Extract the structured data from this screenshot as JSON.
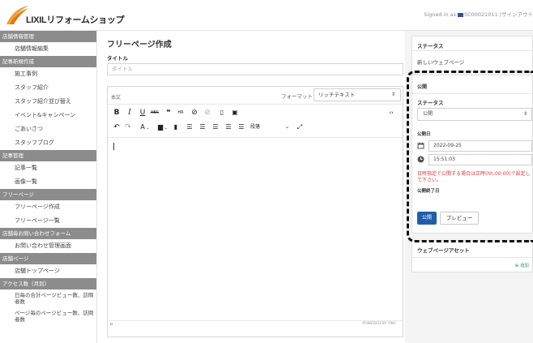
{
  "header": {
    "logo_text": "LIXILリフォームショップ",
    "signed_in_prefix": "Signed in as",
    "user_id": "SC00021011",
    "signout": "|サインアウト"
  },
  "sidebar": {
    "sections": [
      {
        "title": "店舗情報管理",
        "items": [
          {
            "label": "店舗情報編集"
          }
        ]
      },
      {
        "title": "記事新規作成",
        "items": [
          {
            "label": "施工事例"
          },
          {
            "label": "スタッフ紹介"
          },
          {
            "label": "スタッフ紹介並び替え"
          },
          {
            "label": "イベント&キャンペーン"
          },
          {
            "label": "ごあいさつ"
          },
          {
            "label": "スタッフブログ"
          }
        ]
      },
      {
        "title": "記事管理",
        "items": [
          {
            "label": "記事一覧"
          },
          {
            "label": "画像一覧"
          }
        ]
      },
      {
        "title": "フリーページ",
        "items": [
          {
            "label": "フリーページ作成"
          },
          {
            "label": "フリーページ一覧"
          }
        ]
      },
      {
        "title": "店舗毎お問い合わせフォーム",
        "items": [
          {
            "label": "お問い合わせ管理画面"
          }
        ]
      },
      {
        "title": "店舗ページ",
        "items": [
          {
            "label": "店舗トップページ"
          }
        ]
      },
      {
        "title": "アクセス数（月別）",
        "items": [
          {
            "label": "日毎の合計ページビュー数、訪問者数"
          },
          {
            "label": "ページ毎のページビュー数、訪問者数"
          }
        ]
      }
    ]
  },
  "main": {
    "page_title": "フリーページ作成",
    "title_label": "タイトル",
    "title_placeholder": "タイトル",
    "editor": {
      "tab_label": "本文",
      "format_label": "フォーマット",
      "format_value": "リッチテキスト",
      "paragraph_select": "段落",
      "status_path": "p",
      "powered_by": "POWERED BY TINY"
    }
  },
  "right": {
    "status_card": {
      "title": "ステータス",
      "value": "新しいウェブページ"
    },
    "publish_card": {
      "title": "公開",
      "status_label": "ステータス",
      "status_value": "公開",
      "date_label": "公開日",
      "date_value": "2022-09-25",
      "time_value": "15:51:03",
      "warning": "日時指定で公開する場合は正時(hh:00:00)で設定して下さい。",
      "end_label": "公開終了日",
      "publish_button": "公開",
      "preview_button": "プレビュー"
    },
    "asset_card": {
      "title": "ウェブページアセット",
      "add_label": "⊕ 追加"
    }
  },
  "colors": {
    "sidebar_section": "#8c8c8c",
    "primary": "#1f5faa",
    "warning": "#d93a3a",
    "add": "#2a9d5a"
  }
}
